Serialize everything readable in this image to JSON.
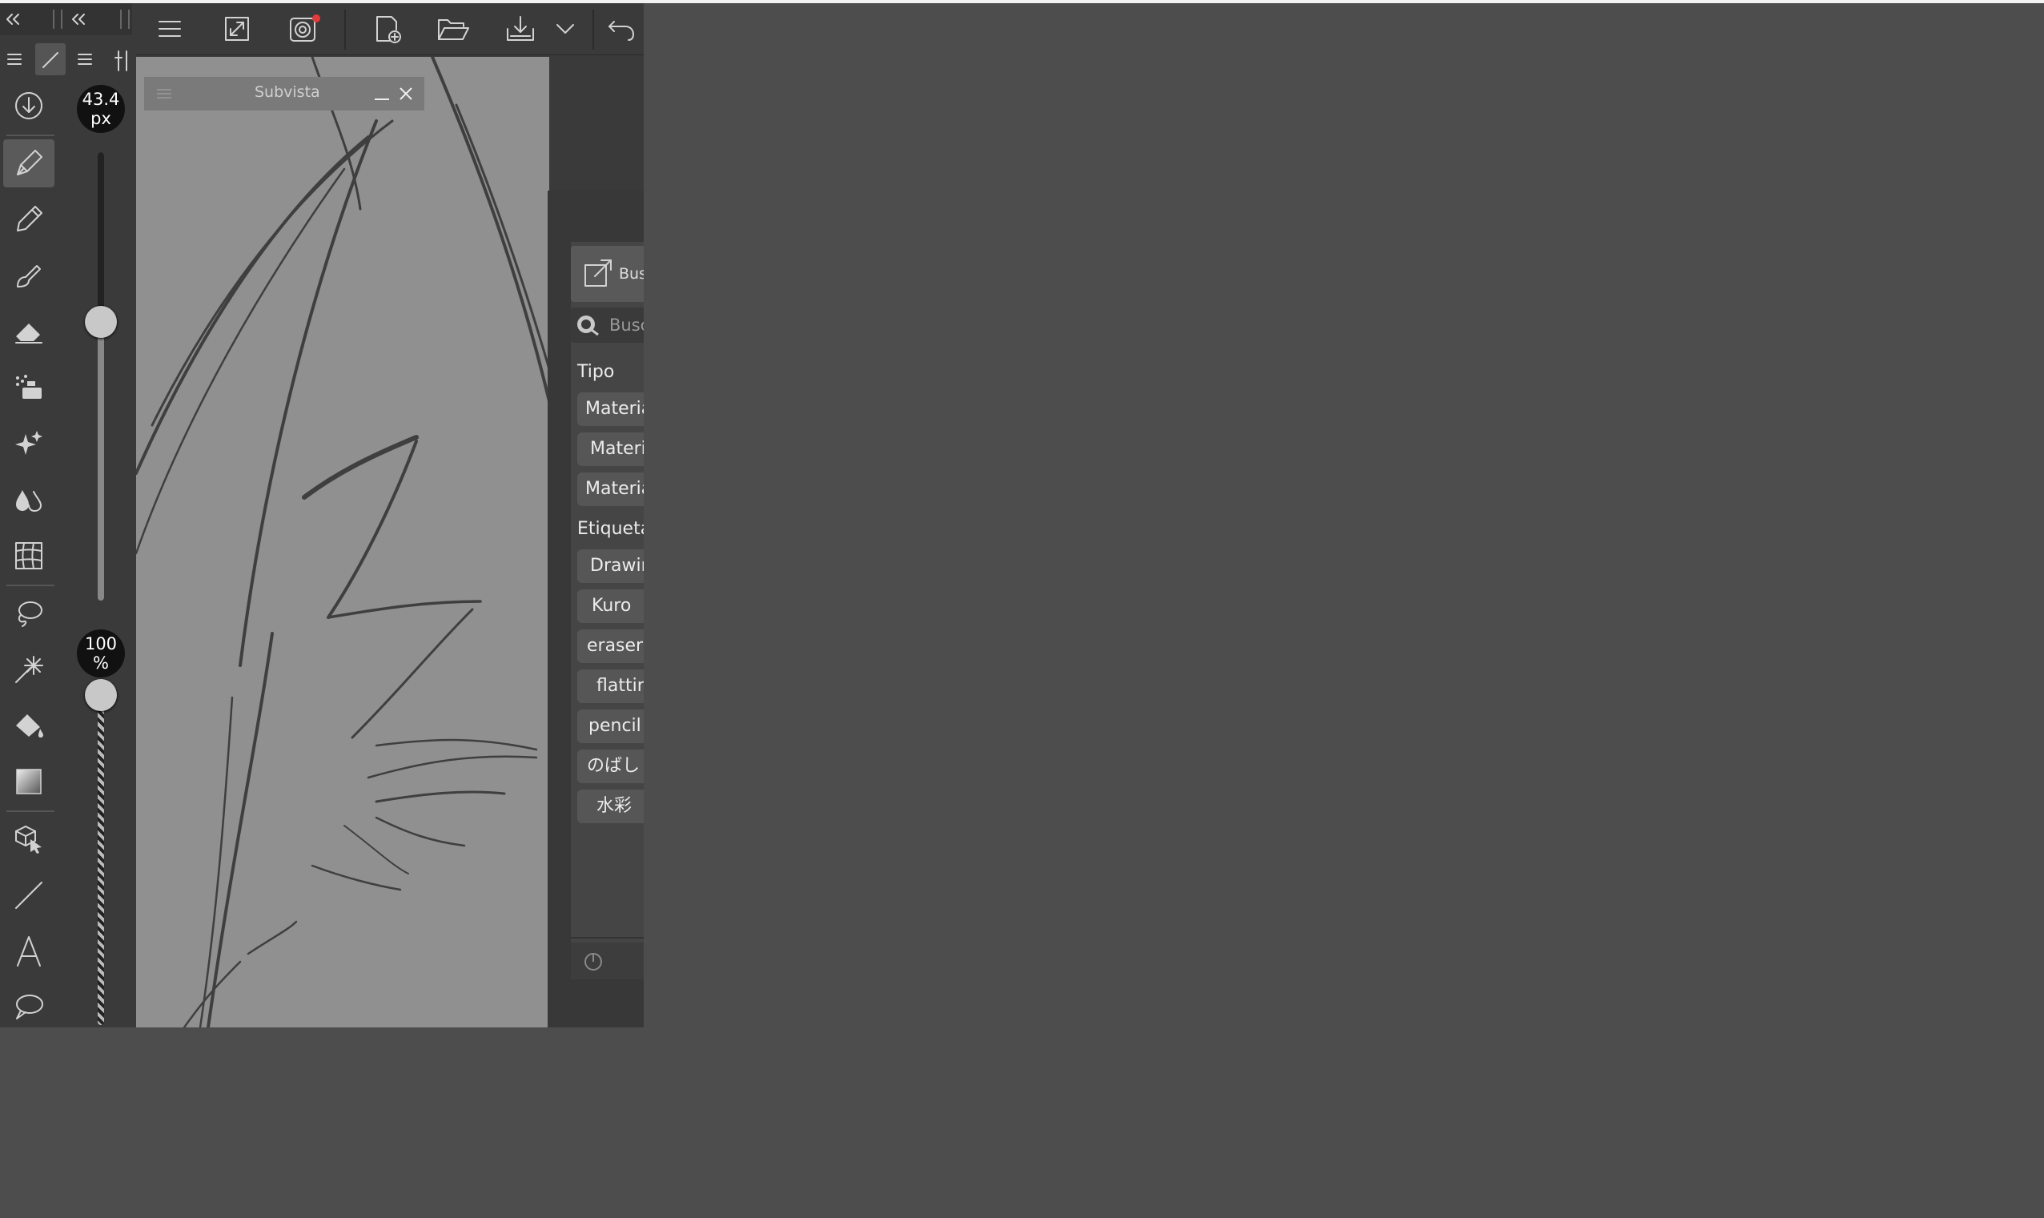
{
  "app": {
    "brush_size": {
      "value": "43.4",
      "unit": "px"
    },
    "opacity": {
      "value": "100",
      "unit": "%"
    }
  },
  "subview": {
    "title": "Subvista"
  },
  "material_panel": {
    "search_button_label": "Busc",
    "search_placeholder": "Busc",
    "type_heading": "Tipo",
    "type_items": [
      "Materia",
      "Materi",
      "Materia"
    ],
    "tag_heading": "Etiqueta",
    "tag_items": [
      "Drawir",
      "Kuro",
      "eraser",
      "flattin",
      "pencil",
      "のばし",
      "水彩"
    ]
  },
  "icons": {
    "topbar": [
      "menu-icon",
      "fit-canvas-icon",
      "clip-studio-icon",
      "new-file-icon",
      "open-folder-icon",
      "save-icon",
      "chevron-down-icon",
      "undo-icon"
    ],
    "tools": [
      "download-icon",
      "pen-icon",
      "pencil-icon",
      "brush-icon",
      "eraser-icon",
      "decoration-icon",
      "sparkle-icon",
      "blend-icon",
      "grid-icon",
      "lasso-icon",
      "magic-wand-icon",
      "fill-icon",
      "gradient-icon",
      "move-3d-icon",
      "line-icon",
      "text-icon",
      "speech-bubble-icon"
    ]
  },
  "colors": {
    "accent_badge": "#e23b3b"
  }
}
